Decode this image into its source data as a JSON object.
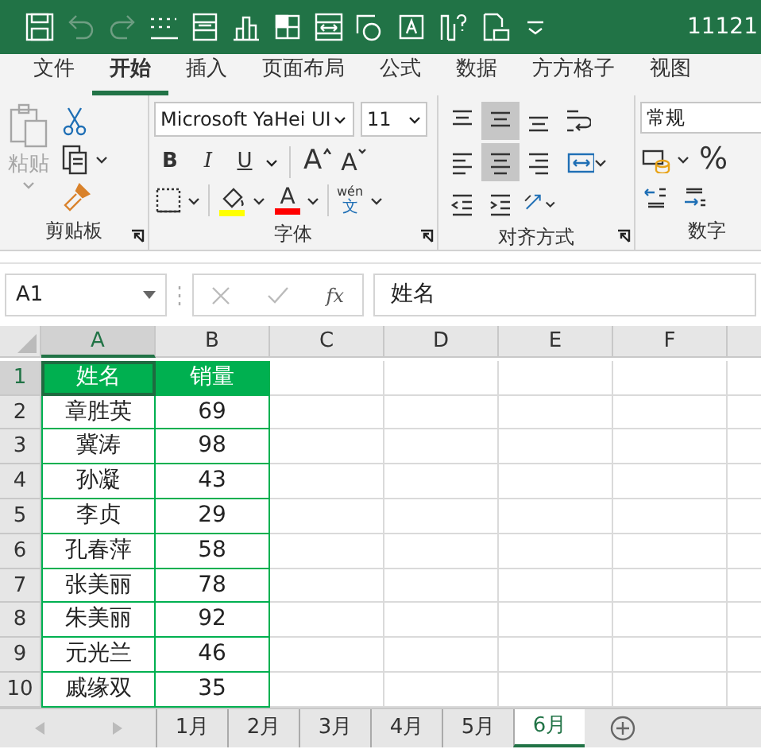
{
  "title_bar": {
    "title": "11121",
    "quick_access": [
      {
        "kind": "save",
        "disabled": false
      },
      {
        "kind": "undo",
        "disabled": true
      },
      {
        "kind": "redo",
        "disabled": true
      },
      {
        "kind": "borders",
        "disabled": false
      },
      {
        "kind": "form",
        "disabled": false
      },
      {
        "kind": "chart",
        "disabled": false
      },
      {
        "kind": "fill",
        "disabled": false
      },
      {
        "kind": "fit",
        "disabled": false
      },
      {
        "kind": "shapes",
        "disabled": false
      },
      {
        "kind": "textbox",
        "disabled": false
      },
      {
        "kind": "help",
        "disabled": false
      },
      {
        "kind": "print",
        "disabled": false
      },
      {
        "kind": "customize",
        "disabled": false
      }
    ]
  },
  "menu_tabs": [
    {
      "label": "文件",
      "selected": false
    },
    {
      "label": "开始",
      "selected": true
    },
    {
      "label": "插入",
      "selected": false
    },
    {
      "label": "页面布局",
      "selected": false
    },
    {
      "label": "公式",
      "selected": false
    },
    {
      "label": "数据",
      "selected": false
    },
    {
      "label": "方方格子",
      "selected": false
    },
    {
      "label": "视图",
      "selected": false
    }
  ],
  "ribbon": {
    "clipboard": {
      "paste_label": "粘贴",
      "paste_disabled": true,
      "group_label": "剪贴板"
    },
    "font": {
      "font_name": "Microsoft YaHei UI",
      "font_size": "11",
      "bold": "B",
      "italic": "I",
      "underline": "U",
      "grow": "A",
      "shrink": "A",
      "font_color_letter": "A",
      "phonetic_top": "wén",
      "phonetic_bottom": "文",
      "group_label": "字体"
    },
    "alignment": {
      "group_label": "对齐方式",
      "buttons": [
        {
          "kind": "top",
          "selected": false
        },
        {
          "kind": "middle",
          "selected": true
        },
        {
          "kind": "bottom",
          "selected": false
        },
        {
          "kind": "wrap",
          "selected": false
        },
        {
          "kind": "left",
          "selected": false
        },
        {
          "kind": "center",
          "selected": true
        },
        {
          "kind": "right",
          "selected": false
        },
        {
          "kind": "merge",
          "selected": false
        },
        {
          "kind": "outdent",
          "selected": false
        },
        {
          "kind": "indent",
          "selected": false
        },
        {
          "kind": "orientation",
          "selected": false
        }
      ]
    },
    "number": {
      "format": "常规",
      "percent": "%",
      "group_label": "数字"
    }
  },
  "formula_bar": {
    "name_box": "A1",
    "fx": "fx",
    "formula": "姓名"
  },
  "sheet": {
    "columns": [
      {
        "label": "A",
        "selected": true
      },
      {
        "label": "B",
        "selected": false
      },
      {
        "label": "C",
        "selected": false
      },
      {
        "label": "D",
        "selected": false
      },
      {
        "label": "E",
        "selected": false
      },
      {
        "label": "F",
        "selected": false
      }
    ],
    "rows": [
      {
        "number": "1",
        "selected": true,
        "kind": "header",
        "cells": [
          "姓名",
          "销量"
        ]
      },
      {
        "number": "2",
        "selected": false,
        "kind": "data",
        "cells": [
          "章胜英",
          "69"
        ]
      },
      {
        "number": "3",
        "selected": false,
        "kind": "data",
        "cells": [
          "冀涛",
          "98"
        ]
      },
      {
        "number": "4",
        "selected": false,
        "kind": "data",
        "cells": [
          "孙凝",
          "43"
        ]
      },
      {
        "number": "5",
        "selected": false,
        "kind": "data",
        "cells": [
          "李贞",
          "29"
        ]
      },
      {
        "number": "6",
        "selected": false,
        "kind": "data",
        "cells": [
          "孔春萍",
          "58"
        ]
      },
      {
        "number": "7",
        "selected": false,
        "kind": "data",
        "cells": [
          "张美丽",
          "78"
        ]
      },
      {
        "number": "8",
        "selected": false,
        "kind": "data",
        "cells": [
          "朱美丽",
          "92"
        ]
      },
      {
        "number": "9",
        "selected": false,
        "kind": "data",
        "cells": [
          "元光兰",
          "46"
        ]
      },
      {
        "number": "10",
        "selected": false,
        "kind": "data",
        "cells": [
          "戚缘双",
          "35"
        ]
      }
    ]
  },
  "sheet_tabs": [
    {
      "label": "1月",
      "selected": false
    },
    {
      "label": "2月",
      "selected": false
    },
    {
      "label": "3月",
      "selected": false
    },
    {
      "label": "4月",
      "selected": false
    },
    {
      "label": "5月",
      "selected": false
    },
    {
      "label": "6月",
      "selected": true
    }
  ]
}
